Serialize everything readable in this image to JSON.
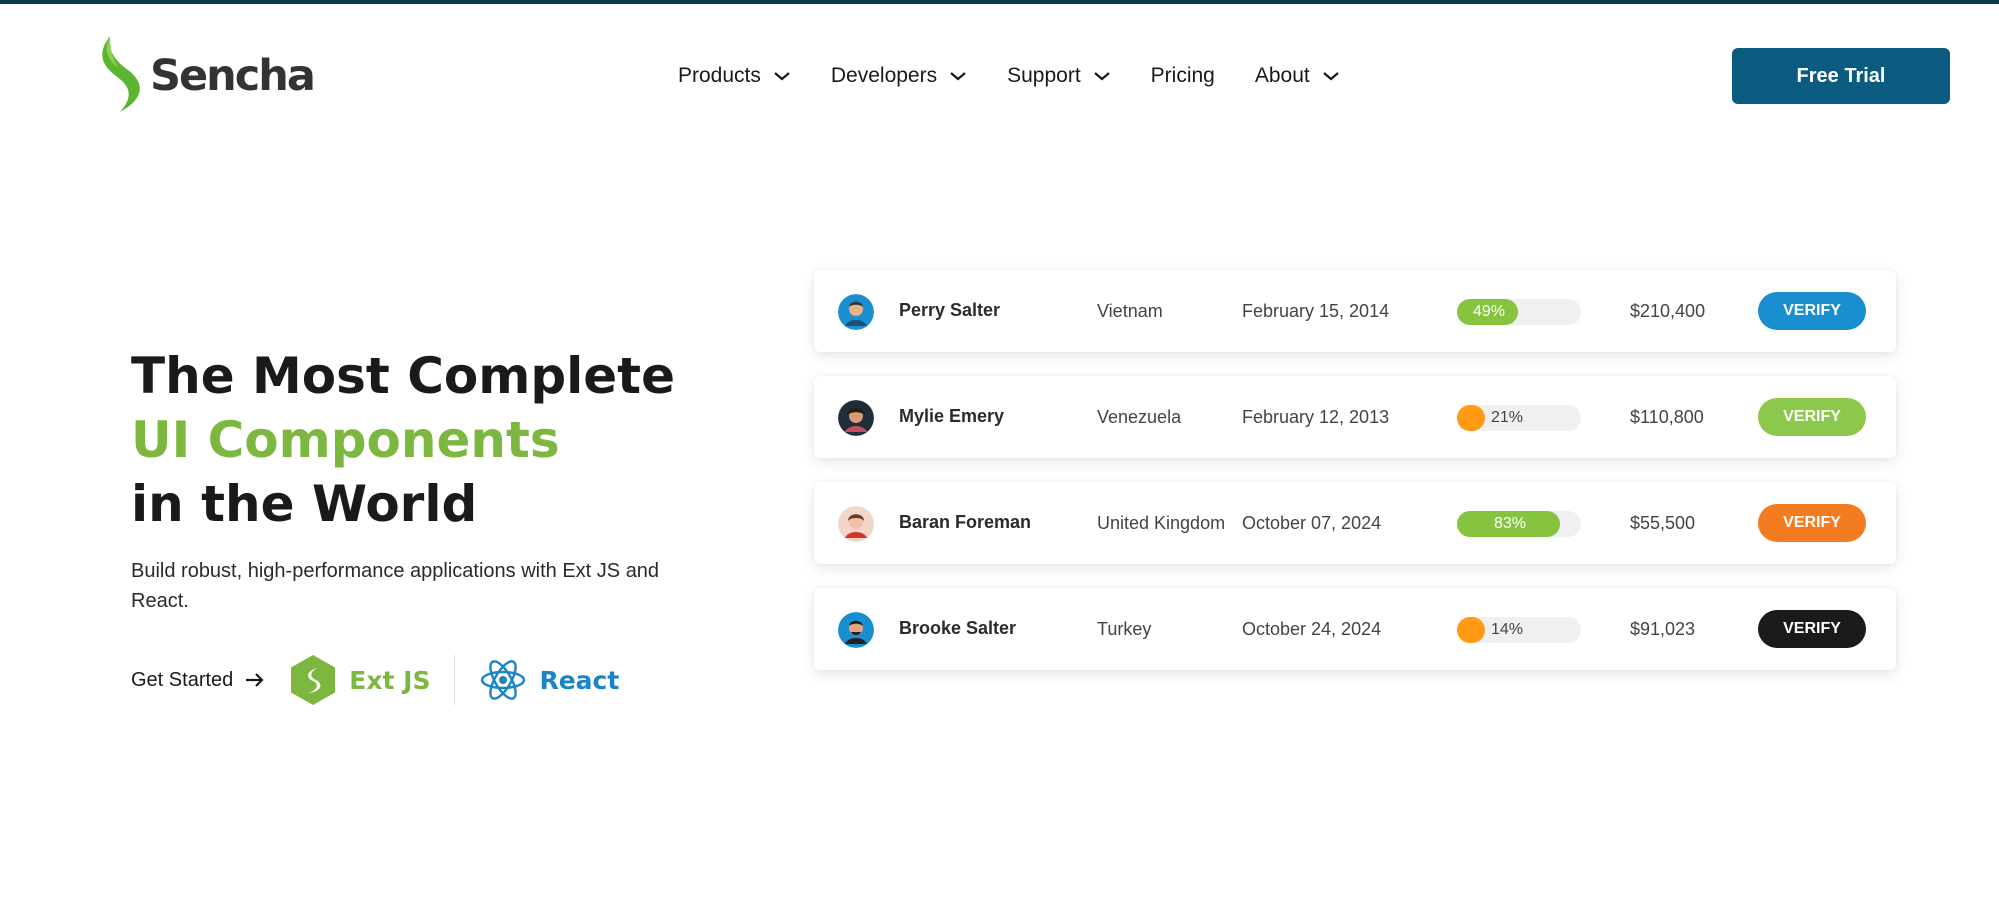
{
  "header": {
    "logo_text": "Sencha",
    "nav": [
      {
        "label": "Products",
        "has_dropdown": true
      },
      {
        "label": "Developers",
        "has_dropdown": true
      },
      {
        "label": "Support",
        "has_dropdown": true
      },
      {
        "label": "Pricing",
        "has_dropdown": false
      },
      {
        "label": "About",
        "has_dropdown": true
      }
    ],
    "cta_label": "Free Trial"
  },
  "hero": {
    "title_line1": "The Most Complete",
    "title_line2": "UI Components",
    "title_line3": "in the World",
    "subtitle": "Build robust, high-performance applications with Ext JS and React.",
    "get_started": "Get Started",
    "extjs_label": "Ext JS",
    "react_label": "React"
  },
  "table": {
    "rows": [
      {
        "name": "Perry Salter",
        "country": "Vietnam",
        "date": "February 15, 2014",
        "progress": 49,
        "progress_label": "49%",
        "progress_color": "#86c440",
        "amount": "$210,400",
        "button": "VERIFY",
        "button_color": "#1a8fd0"
      },
      {
        "name": "Mylie Emery",
        "country": "Venezuela",
        "date": "February 12, 2013",
        "progress": 21,
        "progress_label": "21%",
        "progress_color": "#ff9a12",
        "amount": "$110,800",
        "button": "VERIFY",
        "button_color": "#8cc84b"
      },
      {
        "name": "Baran Foreman",
        "country": "United Kingdom",
        "date": "October 07, 2024",
        "progress": 83,
        "progress_label": "83%",
        "progress_color": "#86c440",
        "amount": "$55,500",
        "button": "VERIFY",
        "button_color": "#f47c20"
      },
      {
        "name": "Brooke Salter",
        "country": "Turkey",
        "date": "October 24, 2024",
        "progress": 14,
        "progress_label": "14%",
        "progress_color": "#ff9a12",
        "amount": "$91,023",
        "button": "VERIFY",
        "button_color": "#1a1a1a"
      }
    ]
  },
  "colors": {
    "brand_green": "#7cb83f",
    "brand_blue": "#0b5b80",
    "react_blue": "#1a84c7"
  }
}
